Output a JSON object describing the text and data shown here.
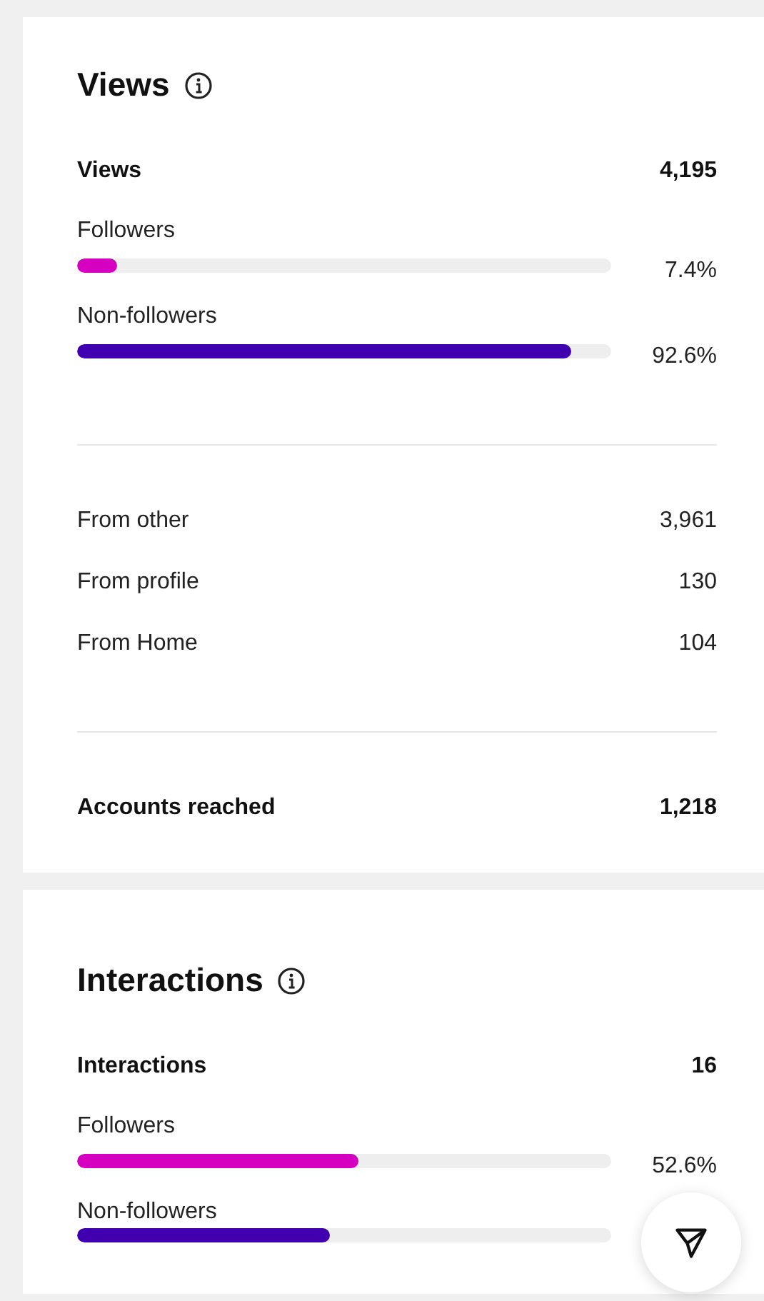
{
  "sections": [
    {
      "title": "Views",
      "total": {
        "label": "Views",
        "value": "4,195"
      },
      "bars": [
        {
          "label": "Followers",
          "level": 0.074,
          "reading": "7.4%",
          "color": "#d600c0"
        },
        {
          "label": "Non-followers",
          "level": 0.926,
          "reading": "92.6%",
          "color": "#4100b0"
        }
      ],
      "sources": [
        {
          "label": "From other",
          "value": "3,961"
        },
        {
          "label": "From profile",
          "value": "130"
        },
        {
          "label": "From Home",
          "value": "104"
        }
      ],
      "reached": {
        "label": "Accounts reached",
        "value": "1,218"
      }
    },
    {
      "title": "Interactions",
      "total": {
        "label": "Interactions",
        "value": "16"
      },
      "bars": [
        {
          "label": "Followers",
          "level": 0.526,
          "reading": "52.6%",
          "color": "#d600c0"
        },
        {
          "label": "Non-followers",
          "level": 0.474,
          "color": "#4100b0"
        }
      ]
    }
  ]
}
